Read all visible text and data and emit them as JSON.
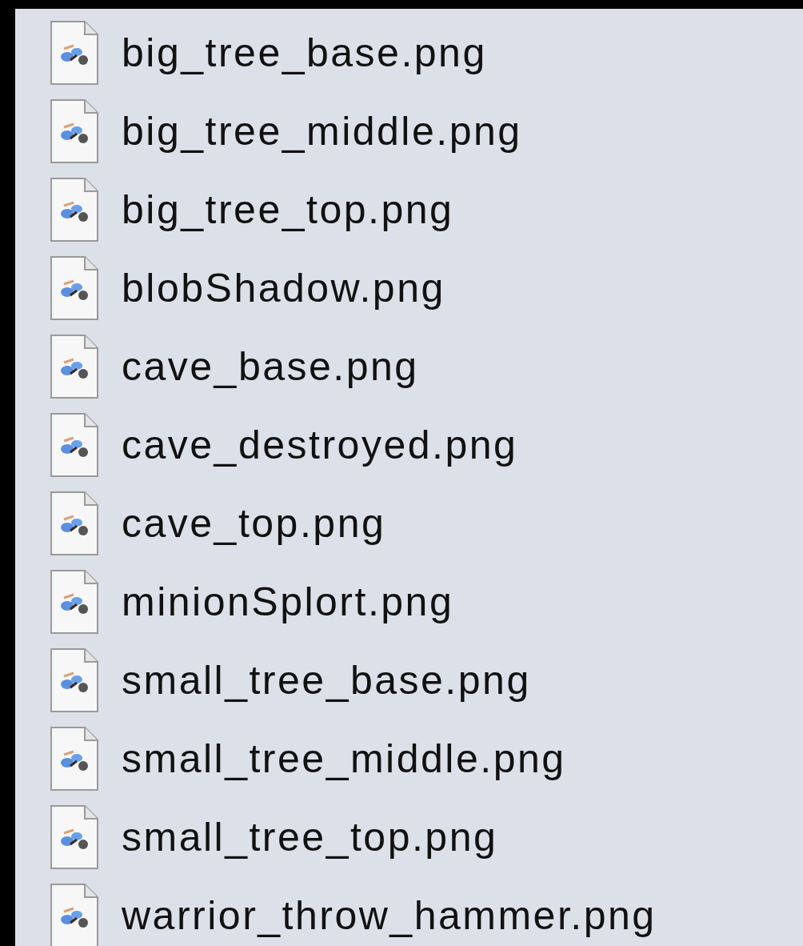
{
  "files": [
    {
      "name": "big_tree_base.png"
    },
    {
      "name": "big_tree_middle.png"
    },
    {
      "name": "big_tree_top.png"
    },
    {
      "name": "blobShadow.png"
    },
    {
      "name": "cave_base.png"
    },
    {
      "name": "cave_destroyed.png"
    },
    {
      "name": "cave_top.png"
    },
    {
      "name": "minionSplort.png"
    },
    {
      "name": "small_tree_base.png"
    },
    {
      "name": "small_tree_middle.png"
    },
    {
      "name": "small_tree_top.png"
    },
    {
      "name": "warrior_throw_hammer.png"
    }
  ]
}
